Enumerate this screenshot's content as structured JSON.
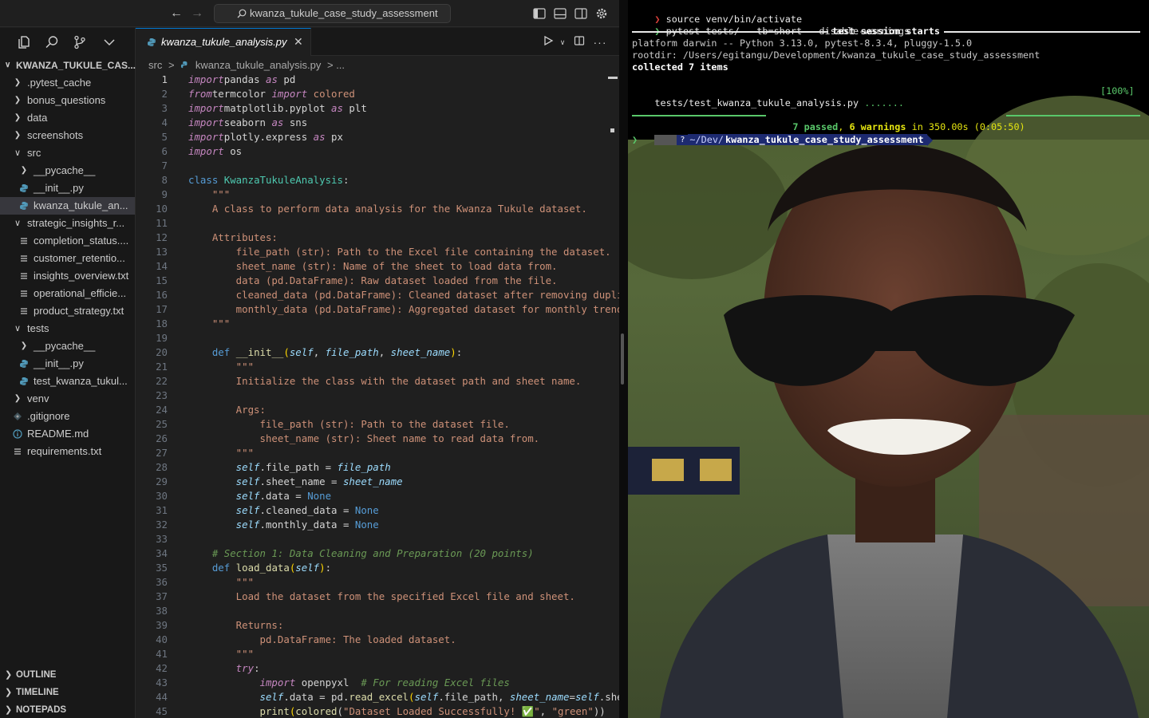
{
  "editor": {
    "search_text": "kwanza_tukule_case_study_assessment",
    "explorer_title": "KWANZA_TUKULE_CAS...",
    "tree": [
      {
        "label": ".pytest_cache",
        "type": "folder",
        "depth": 1,
        "expanded": false
      },
      {
        "label": "bonus_questions",
        "type": "folder",
        "depth": 1,
        "expanded": false
      },
      {
        "label": "data",
        "type": "folder",
        "depth": 1,
        "expanded": false
      },
      {
        "label": "screenshots",
        "type": "folder",
        "depth": 1,
        "expanded": false
      },
      {
        "label": "src",
        "type": "folder",
        "depth": 1,
        "expanded": true
      },
      {
        "label": "__pycache__",
        "type": "folder",
        "depth": 2,
        "expanded": false
      },
      {
        "label": "__init__.py",
        "type": "python",
        "depth": 2
      },
      {
        "label": "kwanza_tukule_an...",
        "type": "python",
        "depth": 2,
        "selected": true
      },
      {
        "label": "strategic_insights_r...",
        "type": "folder",
        "depth": 1,
        "expanded": true
      },
      {
        "label": "completion_status....",
        "type": "text",
        "depth": 2
      },
      {
        "label": "customer_retentio...",
        "type": "text",
        "depth": 2
      },
      {
        "label": "insights_overview.txt",
        "type": "text",
        "depth": 2
      },
      {
        "label": "operational_efficie...",
        "type": "text",
        "depth": 2
      },
      {
        "label": "product_strategy.txt",
        "type": "text",
        "depth": 2
      },
      {
        "label": "tests",
        "type": "folder",
        "depth": 1,
        "expanded": true
      },
      {
        "label": "__pycache__",
        "type": "folder",
        "depth": 2,
        "expanded": false
      },
      {
        "label": "__init__.py",
        "type": "python",
        "depth": 2
      },
      {
        "label": "test_kwanza_tukul...",
        "type": "python",
        "depth": 2
      },
      {
        "label": "venv",
        "type": "folder",
        "depth": 1,
        "expanded": false
      },
      {
        "label": ".gitignore",
        "type": "git",
        "depth": 1
      },
      {
        "label": "README.md",
        "type": "info",
        "depth": 1
      },
      {
        "label": "requirements.txt",
        "type": "text",
        "depth": 1
      }
    ],
    "bottom_sections": [
      "OUTLINE",
      "TIMELINE",
      "NOTEPADS"
    ],
    "tab_label": "kwanza_tukule_analysis.py",
    "breadcrumb": [
      "src",
      ">",
      "kwanza_tukule_analysis.py",
      "> ..."
    ],
    "current_line": 1,
    "code": [
      [
        [
          "kw",
          "import"
        ],
        [
          "",
          "pandas "
        ],
        [
          "kw",
          "as"
        ],
        [
          "",
          " pd"
        ]
      ],
      [
        [
          "kw",
          "from"
        ],
        [
          "",
          "termcolor "
        ],
        [
          "kw",
          "import"
        ],
        [
          "str",
          " colored"
        ]
      ],
      [
        [
          "kw",
          "import"
        ],
        [
          "",
          "matplotlib.pyplot "
        ],
        [
          "kw",
          "as"
        ],
        [
          "",
          " plt"
        ]
      ],
      [
        [
          "kw",
          "import"
        ],
        [
          "",
          "seaborn "
        ],
        [
          "kw",
          "as"
        ],
        [
          "",
          " sns"
        ]
      ],
      [
        [
          "kw",
          "import"
        ],
        [
          "",
          "plotly.express "
        ],
        [
          "kw",
          "as"
        ],
        [
          "",
          " px"
        ]
      ],
      [
        [
          "kw",
          "import"
        ],
        [
          "",
          " os"
        ]
      ],
      [],
      [
        [
          "kwd",
          "class "
        ],
        [
          "cls",
          "KwanzaTukuleAnalysis"
        ],
        [
          "",
          ":"
        ]
      ],
      [
        [
          "doc",
          "    \"\"\""
        ]
      ],
      [
        [
          "doc",
          "    A class to perform data analysis for the Kwanza Tukule dataset."
        ]
      ],
      [],
      [
        [
          "doc",
          "    Attributes:"
        ]
      ],
      [
        [
          "doc",
          "        file_path (str): Path to the Excel file containing the dataset."
        ]
      ],
      [
        [
          "doc",
          "        sheet_name (str): Name of the sheet to load data from."
        ]
      ],
      [
        [
          "doc",
          "        data (pd.DataFrame): Raw dataset loaded from the file."
        ]
      ],
      [
        [
          "doc",
          "        cleaned_data (pd.DataFrame): Cleaned dataset after removing duplica"
        ]
      ],
      [
        [
          "doc",
          "        monthly_data (pd.DataFrame): Aggregated dataset for monthly trends."
        ]
      ],
      [
        [
          "doc",
          "    \"\"\""
        ]
      ],
      [],
      [
        [
          "kwd",
          "    def "
        ],
        [
          "fn",
          "__init__"
        ],
        [
          "brk",
          "("
        ],
        [
          "slf",
          "self"
        ],
        [
          "",
          ", "
        ],
        [
          "par",
          "file_path"
        ],
        [
          "",
          ", "
        ],
        [
          "par",
          "sheet_name"
        ],
        [
          "brk",
          ")"
        ],
        [
          "",
          ":"
        ]
      ],
      [
        [
          "doc",
          "        \"\"\""
        ]
      ],
      [
        [
          "doc",
          "        Initialize the class with the dataset path and sheet name."
        ]
      ],
      [],
      [
        [
          "doc",
          "        Args:"
        ]
      ],
      [
        [
          "doc",
          "            file_path (str): Path to the dataset file."
        ]
      ],
      [
        [
          "doc",
          "            sheet_name (str): Sheet name to read data from."
        ]
      ],
      [
        [
          "doc",
          "        \"\"\""
        ]
      ],
      [
        [
          "slf",
          "        self"
        ],
        [
          "",
          ".file_path = "
        ],
        [
          "par",
          "file_path"
        ]
      ],
      [
        [
          "slf",
          "        self"
        ],
        [
          "",
          ".sheet_name = "
        ],
        [
          "par",
          "sheet_name"
        ]
      ],
      [
        [
          "slf",
          "        self"
        ],
        [
          "",
          ".data = "
        ],
        [
          "bool",
          "None"
        ]
      ],
      [
        [
          "slf",
          "        self"
        ],
        [
          "",
          ".cleaned_data = "
        ],
        [
          "bool",
          "None"
        ]
      ],
      [
        [
          "slf",
          "        self"
        ],
        [
          "",
          ".monthly_data = "
        ],
        [
          "bool",
          "None"
        ]
      ],
      [],
      [
        [
          "cmt",
          "    # Section 1: Data Cleaning and Preparation (20 points)"
        ]
      ],
      [
        [
          "kwd",
          "    def "
        ],
        [
          "fn",
          "load_data"
        ],
        [
          "brk",
          "("
        ],
        [
          "slf",
          "self"
        ],
        [
          "brk",
          ")"
        ],
        [
          "",
          ":"
        ]
      ],
      [
        [
          "doc",
          "        \"\"\""
        ]
      ],
      [
        [
          "doc",
          "        Load the dataset from the specified Excel file and sheet."
        ]
      ],
      [],
      [
        [
          "doc",
          "        Returns:"
        ]
      ],
      [
        [
          "doc",
          "            pd.DataFrame: The loaded dataset."
        ]
      ],
      [
        [
          "doc",
          "        \"\"\""
        ]
      ],
      [
        [
          "kw",
          "        try"
        ],
        [
          "",
          ":"
        ]
      ],
      [
        [
          "kw",
          "            import"
        ],
        [
          "",
          " openpyxl  "
        ],
        [
          "cmt",
          "# For reading Excel files"
        ]
      ],
      [
        [
          "slf",
          "            self"
        ],
        [
          "",
          ".data = pd."
        ],
        [
          "fn",
          "read_excel"
        ],
        [
          "brk",
          "("
        ],
        [
          "slf",
          "self"
        ],
        [
          "",
          ".file_path, "
        ],
        [
          "par",
          "sheet_name"
        ],
        [
          "",
          "="
        ],
        [
          "slf",
          "self"
        ],
        [
          "",
          ".sheet"
        ]
      ],
      [
        [
          "fn",
          "            print"
        ],
        [
          "brk",
          "("
        ],
        [
          "fn",
          "colored"
        ],
        [
          "",
          "("
        ],
        [
          "str",
          "\"Dataset Loaded Successfully! ✅\""
        ],
        [
          "",
          ", "
        ],
        [
          "str",
          "\"green\""
        ],
        [
          "",
          "))"
        ]
      ]
    ]
  },
  "terminal": {
    "lines": [
      {
        "prefix": "❯ ",
        "text": "source venv/bin/activate"
      },
      {
        "prefix": "❯ ",
        "text": "pytest tests/ --tb=short --disable-warnings"
      },
      {
        "text": "test session starts"
      },
      {
        "text": "platform darwin -- Python 3.13.0, pytest-8.3.4, pluggy-1.5.0"
      },
      {
        "text": "rootdir: /Users/egitangu/Development/kwanza_tukule_case_study_assessment"
      },
      {
        "text": "collected 7 items"
      },
      {
        "text": ""
      },
      {
        "text": "tests/test_kwanza_tukule_analysis.py",
        "dots": ".......",
        "percent": "[100%]"
      },
      {
        "text": ""
      },
      {
        "passed": "7 passed",
        "sep": ", ",
        "warnings": "6 warnings",
        "time": " in 350.00s (0:05:50) "
      }
    ],
    "prompt_path_prefix": "~/Dev/",
    "prompt_path_dir": "kwanza_tukule_case_study_assessment",
    "prompt_symbol": "❯"
  }
}
